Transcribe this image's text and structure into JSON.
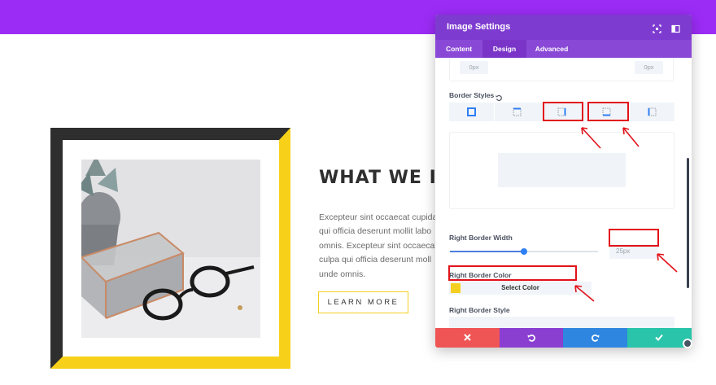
{
  "page": {
    "heading": "WHAT WE I",
    "paragraph_lines": [
      "Excepteur sint occaecat cupidat",
      "qui officia deserunt mollit labo",
      "omnis. Excepteur sint occaecat",
      "culpa qui officia deserunt moll",
      "unde omnis."
    ],
    "button_label": "LEARN MORE",
    "colors": {
      "top_bar": "#9b2cf5",
      "frame_dark": "#2e2e2e",
      "frame_yellow": "#f7d119"
    }
  },
  "modal": {
    "title": "Image Settings",
    "header_icons": [
      "fullscreen-icon",
      "sidebar-toggle-icon"
    ],
    "tabs": [
      {
        "label": "Content",
        "active": false
      },
      {
        "label": "Design",
        "active": true
      },
      {
        "label": "Advanced",
        "active": false
      }
    ],
    "top_inputs": [
      "0px",
      "0px"
    ],
    "border_styles_label": "Border Styles",
    "border_style_options": [
      "all-sides",
      "top",
      "right",
      "bottom",
      "left"
    ],
    "right_border_width_label": "Right Border Width",
    "right_border_width_value": "25px",
    "right_border_width_fraction": 0.5,
    "right_border_color_label": "Right Border Color",
    "select_color_label": "Select Color",
    "selected_color": "#f5cf1f",
    "right_border_style_label": "Right Border Style",
    "footer_buttons": [
      {
        "name": "discard",
        "icon": "close-icon",
        "color": "#ef5555"
      },
      {
        "name": "undo",
        "icon": "undo-icon",
        "color": "#8a3fd1"
      },
      {
        "name": "redo",
        "icon": "redo-icon",
        "color": "#2f86e0"
      },
      {
        "name": "save",
        "icon": "check-icon",
        "color": "#29c4a9"
      }
    ],
    "colors": {
      "header": "#7e3bd0",
      "tabs": "#8a48d7",
      "annotation": "#e2121b"
    }
  }
}
